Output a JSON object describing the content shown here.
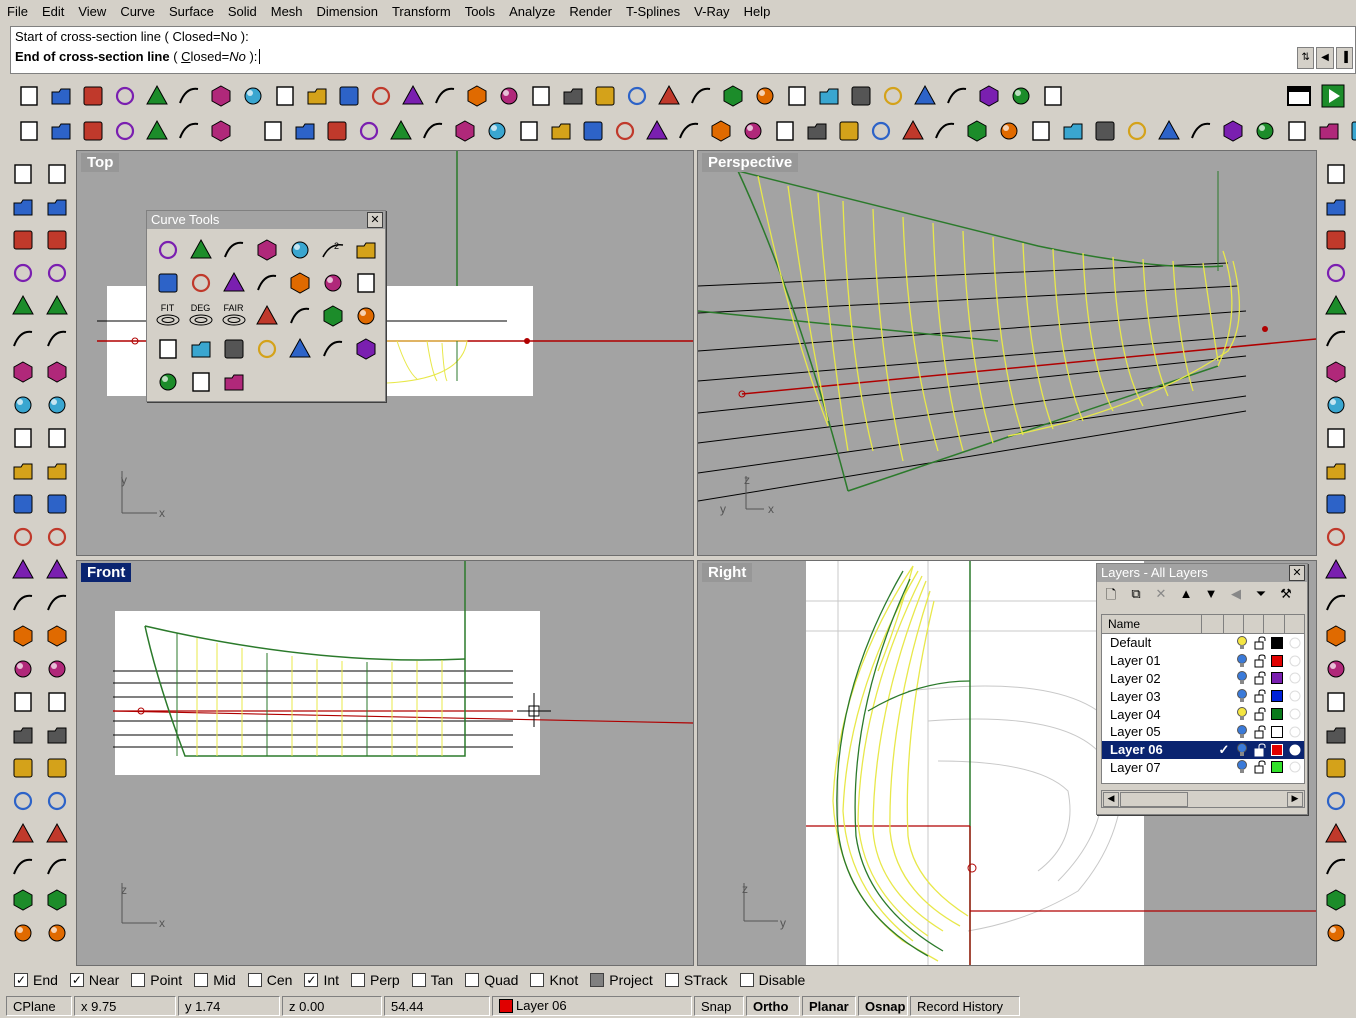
{
  "menubar": [
    "File",
    "Edit",
    "View",
    "Curve",
    "Surface",
    "Solid",
    "Mesh",
    "Dimension",
    "Transform",
    "Tools",
    "Analyze",
    "Render",
    "T-Splines",
    "V-Ray",
    "Help"
  ],
  "command": {
    "history": "Start of cross-section line ( Closed=No ):",
    "prompt": "End of cross-section line",
    "option_prefix": " ( ",
    "option_c": "C",
    "option_rest": "losed=",
    "option_value": "No",
    "option_end": " ):"
  },
  "viewports": {
    "top": "Top",
    "perspective": "Perspective",
    "front": "Front",
    "right": "Right"
  },
  "axes": {
    "x": "x",
    "y": "y",
    "z": "z"
  },
  "curve_tools": {
    "title": "Curve Tools",
    "labels": {
      "fit": "FIT",
      "deg": "DEG",
      "fair": "FAIR",
      "num2": "2"
    }
  },
  "layers_panel": {
    "title": "Layers - All Layers",
    "column_name": "Name",
    "selected": "Layer 06",
    "layers": [
      {
        "name": "Default",
        "color": "#000000",
        "bulb": "#f5e642"
      },
      {
        "name": "Layer 01",
        "color": "#e00000",
        "bulb": "#3a7ad9"
      },
      {
        "name": "Layer 02",
        "color": "#7a1fb0",
        "bulb": "#3a7ad9"
      },
      {
        "name": "Layer 03",
        "color": "#0022d8",
        "bulb": "#3a7ad9"
      },
      {
        "name": "Layer 04",
        "color": "#0a7a1a",
        "bulb": "#f5e642"
      },
      {
        "name": "Layer 05",
        "color": "#ffffff",
        "bulb": "#3a7ad9"
      },
      {
        "name": "Layer 06",
        "color": "#e00000",
        "bulb": "#3a7ad9"
      },
      {
        "name": "Layer 07",
        "color": "#32e02a",
        "bulb": "#3a7ad9"
      }
    ]
  },
  "osnap": [
    {
      "label": "End",
      "checked": true
    },
    {
      "label": "Near",
      "checked": true
    },
    {
      "label": "Point",
      "checked": false
    },
    {
      "label": "Mid",
      "checked": false
    },
    {
      "label": "Cen",
      "checked": false
    },
    {
      "label": "Int",
      "checked": true
    },
    {
      "label": "Perp",
      "checked": false
    },
    {
      "label": "Tan",
      "checked": false
    },
    {
      "label": "Quad",
      "checked": false
    },
    {
      "label": "Knot",
      "checked": false
    },
    {
      "label": "Project",
      "checked": false
    },
    {
      "label": "STrack",
      "checked": false
    },
    {
      "label": "Disable",
      "checked": false
    }
  ],
  "status": {
    "cplane": "CPlane",
    "x": "x 9.75",
    "y": "y 1.74",
    "z": "z 0.00",
    "dist": "54.44",
    "layer": "Layer 06",
    "layer_color": "#e00000",
    "snap": "Snap",
    "ortho": "Ortho",
    "planar": "Planar",
    "osnap": "Osnap",
    "record": "Record History"
  },
  "icons": {
    "toolbar1": [
      "new-icon",
      "open-icon",
      "save-icon",
      "print-icon",
      "import-icon",
      "cut-icon",
      "copy-icon",
      "paste-icon",
      "undo-icon",
      "pan-icon",
      "rotate-icon",
      "zoom-icon",
      "zoom-window-icon",
      "zoom-extents-icon",
      "zoom-selected-icon",
      "rotate-view-icon",
      "four-view-icon",
      "car-icon",
      "grid-icon",
      "cplane-icon",
      "points-on-icon",
      "light-icon",
      "lock-icon",
      "layer-icon",
      "color-wheel-icon",
      "wire-sphere-icon",
      "render-sphere-icon",
      "blue-sphere-icon",
      "light-cone-icon",
      "gear-icon",
      "dimension-icon",
      "cube-icon",
      "help-icon"
    ],
    "toolbar2": [
      "tsplines-box-icon",
      "tsplines-plane-icon",
      "tsplines-sphere-icon",
      "tsplines-cylinder-icon",
      "tsplines-pipe-icon",
      "tsplines-torus-icon",
      "tsplines-cone-icon",
      "tsplines-quadball-icon",
      "tsplines-face-icon",
      "tsplines-extrude-icon",
      "tsplines-bridge-icon",
      "tsplines-insert-icon",
      "tsplines-loft-icon",
      "tsplines-weld-icon",
      "tsplines-crease-icon",
      "tsplines-merge-icon",
      "tsplines-thicken-icon",
      "tsplines-fill-icon",
      "tsplines-append-icon",
      "tsplines-subdivide-icon",
      "tsplines-delete-icon",
      "tsplines-grid-icon",
      "tsplines-mirror-icon",
      "tsplines-symmetry-icon",
      "tsplines-smooth-icon",
      "tsplines-box-mode-icon",
      "tsplines-match-icon",
      "tsplines-convert-icon",
      "tsplines-star-icon",
      "tsplines-split-icon",
      "tsplines-unweld-icon",
      "tsplines-pipe2-icon",
      "tsplines-scissors-icon",
      "tsplines-solid-icon",
      "tsplines-manip-icon",
      "tsplines-axis-icon"
    ]
  }
}
